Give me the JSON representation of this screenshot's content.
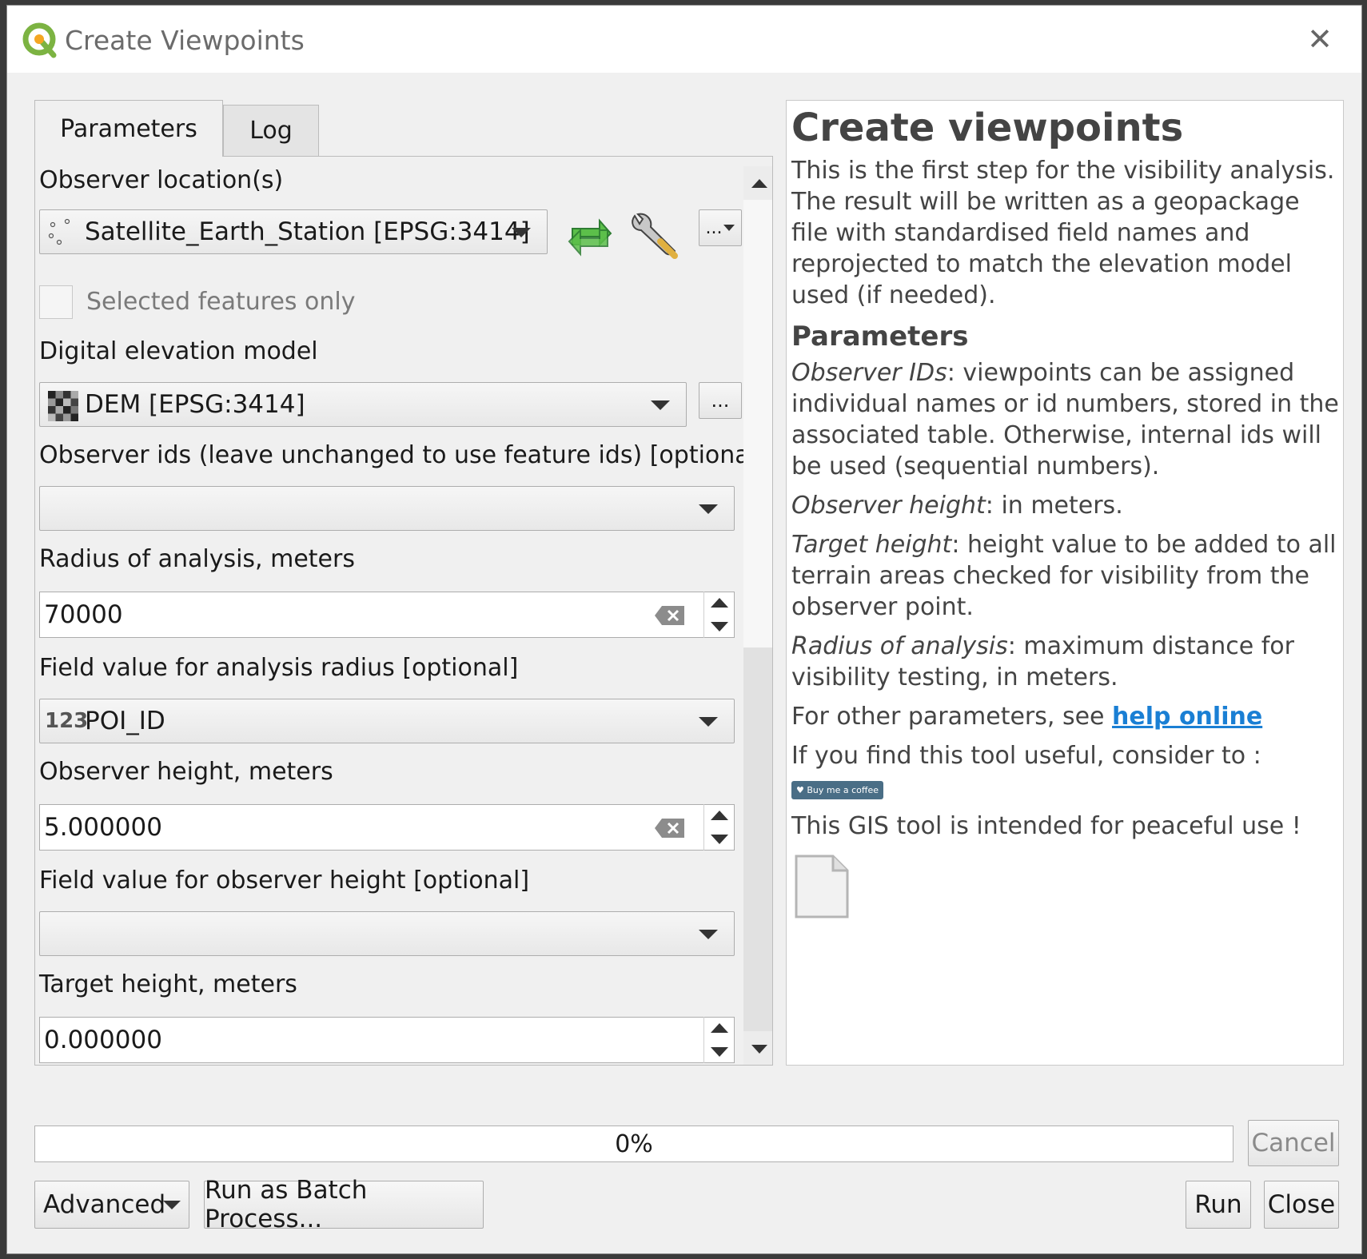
{
  "window": {
    "title": "Create Viewpoints"
  },
  "tabs": {
    "parameters": "Parameters",
    "log": "Log"
  },
  "params": {
    "observer_label": "Observer location(s)",
    "observer_value": "Satellite_Earth_Station [EPSG:3414]",
    "selected_only": "Selected features only",
    "dem_label": "Digital elevation model",
    "dem_value": "DEM [EPSG:3414]",
    "ids_label": "Observer ids (leave unchanged to use feature ids) [optional]",
    "ids_value": "",
    "radius_label": "Radius of analysis, meters",
    "radius_value": "70000",
    "radius_field_label": "Field value for analysis radius [optional]",
    "radius_field_prefix": "123",
    "radius_field_value": "POI_ID",
    "obs_height_label": "Observer height, meters",
    "obs_height_value": "5.000000",
    "obs_height_field_label": "Field value for observer height [optional]",
    "obs_height_field_value": "",
    "target_height_label": "Target height, meters",
    "target_height_value": "0.000000",
    "ellipsis": "..."
  },
  "help": {
    "title": "Create viewpoints",
    "intro": "This is the first step for the visibility analysis. The result will be written as a geopackage file with standardised field names and reprojected to match the elevation model used (if needed).",
    "params_heading": "Parameters",
    "obs_ids_term": "Observer IDs",
    "obs_ids_text": ": viewpoints can be assigned individual names or id numbers, stored in the associated table. Otherwise, internal ids will be used (sequential numbers).",
    "obs_height_term": "Observer height",
    "obs_height_text": ": in meters.",
    "target_height_term": "Target height",
    "target_height_text": ": height value to be added to all terrain areas checked for visibility from the observer point.",
    "radius_term": "Radius of analysis",
    "radius_text": ": maximum distance for visibility testing, in meters.",
    "other_text": "For other parameters, see ",
    "help_link": "help online",
    "consider_text": "If you find this tool useful, consider to :",
    "coffee_label": "Buy me a coffee",
    "peaceful_text": "This GIS tool is intended for peaceful use !"
  },
  "bottom": {
    "progress": 0,
    "progress_text": "0%",
    "cancel": "Cancel",
    "advanced": "Advanced",
    "batch": "Run as Batch Process...",
    "run": "Run",
    "close": "Close"
  },
  "colors": {
    "link": "#1a7fd4",
    "refresh_icon": "#4caf50",
    "coffee_badge": "#4a6e86"
  }
}
